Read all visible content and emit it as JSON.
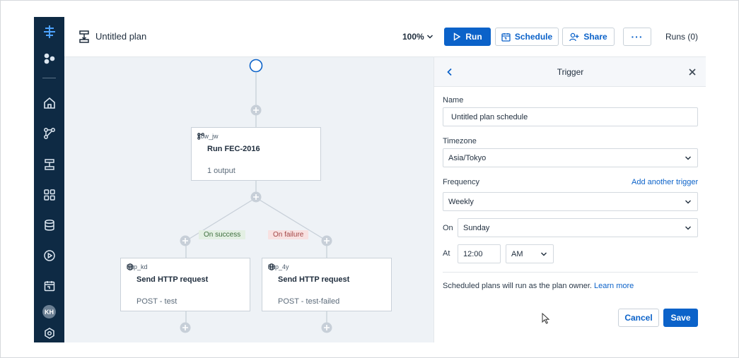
{
  "header": {
    "plan_title": "Untitled plan",
    "zoom": "100%",
    "run_label": "Run",
    "schedule_label": "Schedule",
    "share_label": "Share",
    "more_label": "···",
    "runs_label": "Runs (0)"
  },
  "sidebar": {
    "avatar_initials": "KH",
    "icons": [
      "logo-icon",
      "apps-icon",
      "home-icon",
      "flows-icon",
      "plans-icon",
      "grid-icon",
      "database-icon",
      "runs-icon",
      "calendar-icon",
      "settings-icon"
    ]
  },
  "canvas": {
    "flow_node": {
      "tag": "flow_jw",
      "title": "Run FEC-2016",
      "subtitle": "1 output"
    },
    "success_label": "On success",
    "failure_label": "On failure",
    "http_success": {
      "tag": "http_kd",
      "title": "Send HTTP request",
      "subtitle": "POST - test"
    },
    "http_failure": {
      "tag": "http_4y",
      "title": "Send HTTP request",
      "subtitle": "POST - test-failed"
    }
  },
  "panel": {
    "title": "Trigger",
    "name_label": "Name",
    "name_value": "Untitled plan schedule",
    "timezone_label": "Timezone",
    "timezone_value": "Asia/Tokyo",
    "frequency_label": "Frequency",
    "add_trigger_link": "Add another trigger",
    "frequency_value": "Weekly",
    "on_label": "On",
    "on_value": "Sunday",
    "at_label": "At",
    "time_value": "12:00",
    "ampm_value": "AM",
    "note_text": "Scheduled plans will run as the plan owner.",
    "learn_more": "Learn more",
    "cancel_label": "Cancel",
    "save_label": "Save"
  },
  "colors": {
    "sidebar_bg": "#0e2a44",
    "accent": "#0b62c9",
    "canvas_bg": "#eef2f6",
    "success_bg": "#e3efe3",
    "failure_bg": "#f8e1e1"
  }
}
